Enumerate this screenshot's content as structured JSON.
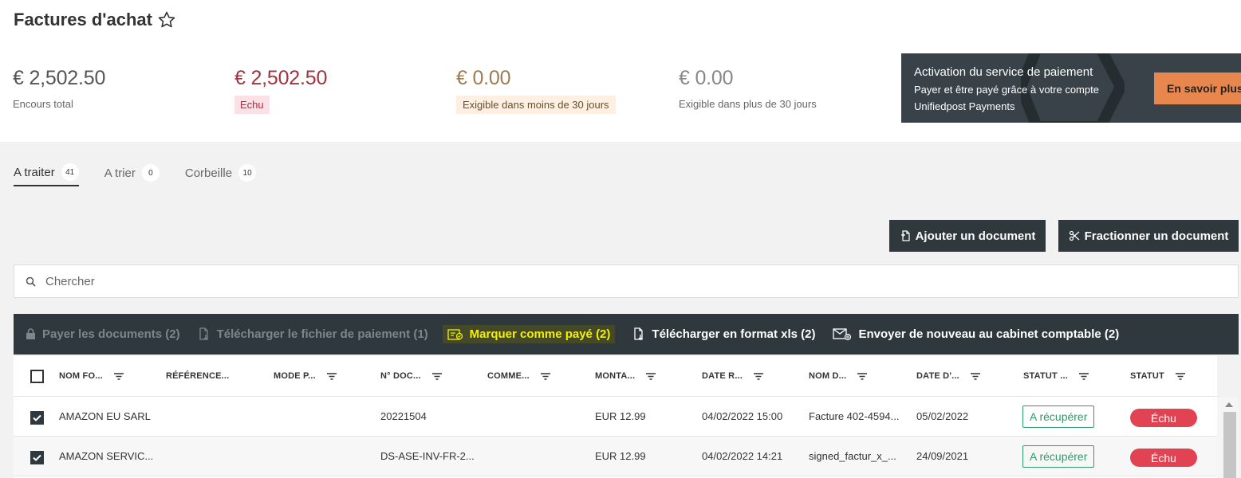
{
  "header": {
    "title": "Factures d'achat",
    "star_icon": "star-outline-icon"
  },
  "stats": [
    {
      "amount": "€ 2,502.50",
      "label": "Encours total",
      "color": "#555555"
    },
    {
      "amount": "€ 2,502.50",
      "label": "Echu",
      "color": "#a0343f"
    },
    {
      "amount": "€ 0.00",
      "label": "Exigible dans moins de 30 jours",
      "color": "#a07b4f"
    },
    {
      "amount": "€ 0.00",
      "label": "Exigible dans plus de 30 jours",
      "color": "#888888"
    }
  ],
  "promo": {
    "title": "Activation du service de paiement",
    "line1": "Payer et être payé grâce à votre compte",
    "line2": "Unifiedpost Payments",
    "button": "En savoir plus"
  },
  "tabs": [
    {
      "label": "A traiter",
      "count": "41",
      "active": true
    },
    {
      "label": "A trier",
      "count": "0",
      "active": false
    },
    {
      "label": "Corbeille",
      "count": "10",
      "active": false
    }
  ],
  "buttons": {
    "add": "Ajouter un document",
    "split": "Fractionner un document"
  },
  "search": {
    "placeholder": "Chercher"
  },
  "actions": [
    {
      "label": "Payer les documents (2)",
      "icon": "lock-icon",
      "state": "disabled"
    },
    {
      "label": "Télécharger le fichier de paiement (1)",
      "icon": "download-file-icon",
      "state": "disabled"
    },
    {
      "label": "Marquer comme payé (2)",
      "icon": "mark-paid-icon",
      "state": "highlight"
    },
    {
      "label": "Télécharger en format xls (2)",
      "icon": "download-xls-icon",
      "state": "enabled"
    },
    {
      "label": "Envoyer de nouveau au cabinet comptable (2)",
      "icon": "email-at-icon",
      "state": "enabled"
    }
  ],
  "table": {
    "columns": [
      "NOM FO...",
      "RÉFÉRENCE...",
      "MODE P...",
      "N° DOC...",
      "COMME...",
      "MONTA...",
      "DATE R...",
      "NOM D...",
      "DATE D'...",
      "STATUT ...",
      "STATUT"
    ],
    "rows": [
      {
        "checked": true,
        "supplier": "AMAZON EU SARL",
        "reference": "",
        "mode": "",
        "doc_no": "20221504",
        "comment": "",
        "amount": "EUR 12.99",
        "date_received": "04/02/2022 15:00",
        "doc_name": "Facture 402-4594...",
        "date_doc": "05/02/2022",
        "status1": "A récupérer",
        "status2": "Échu"
      },
      {
        "checked": true,
        "supplier": "AMAZON SERVIC...",
        "reference": "",
        "mode": "",
        "doc_no": "DS-ASE-INV-FR-2...",
        "comment": "",
        "amount": "EUR 12.99",
        "date_received": "04/02/2022 14:21",
        "doc_name": "signed_factur_x_...",
        "date_doc": "24/09/2021",
        "status1": "A récupérer",
        "status2": "Échu"
      }
    ]
  },
  "colors": {
    "dark": "#2f383d",
    "accent_orange": "#e8874d",
    "danger": "#e14352",
    "success": "#2e9a6b",
    "highlight": "#f5f000"
  }
}
